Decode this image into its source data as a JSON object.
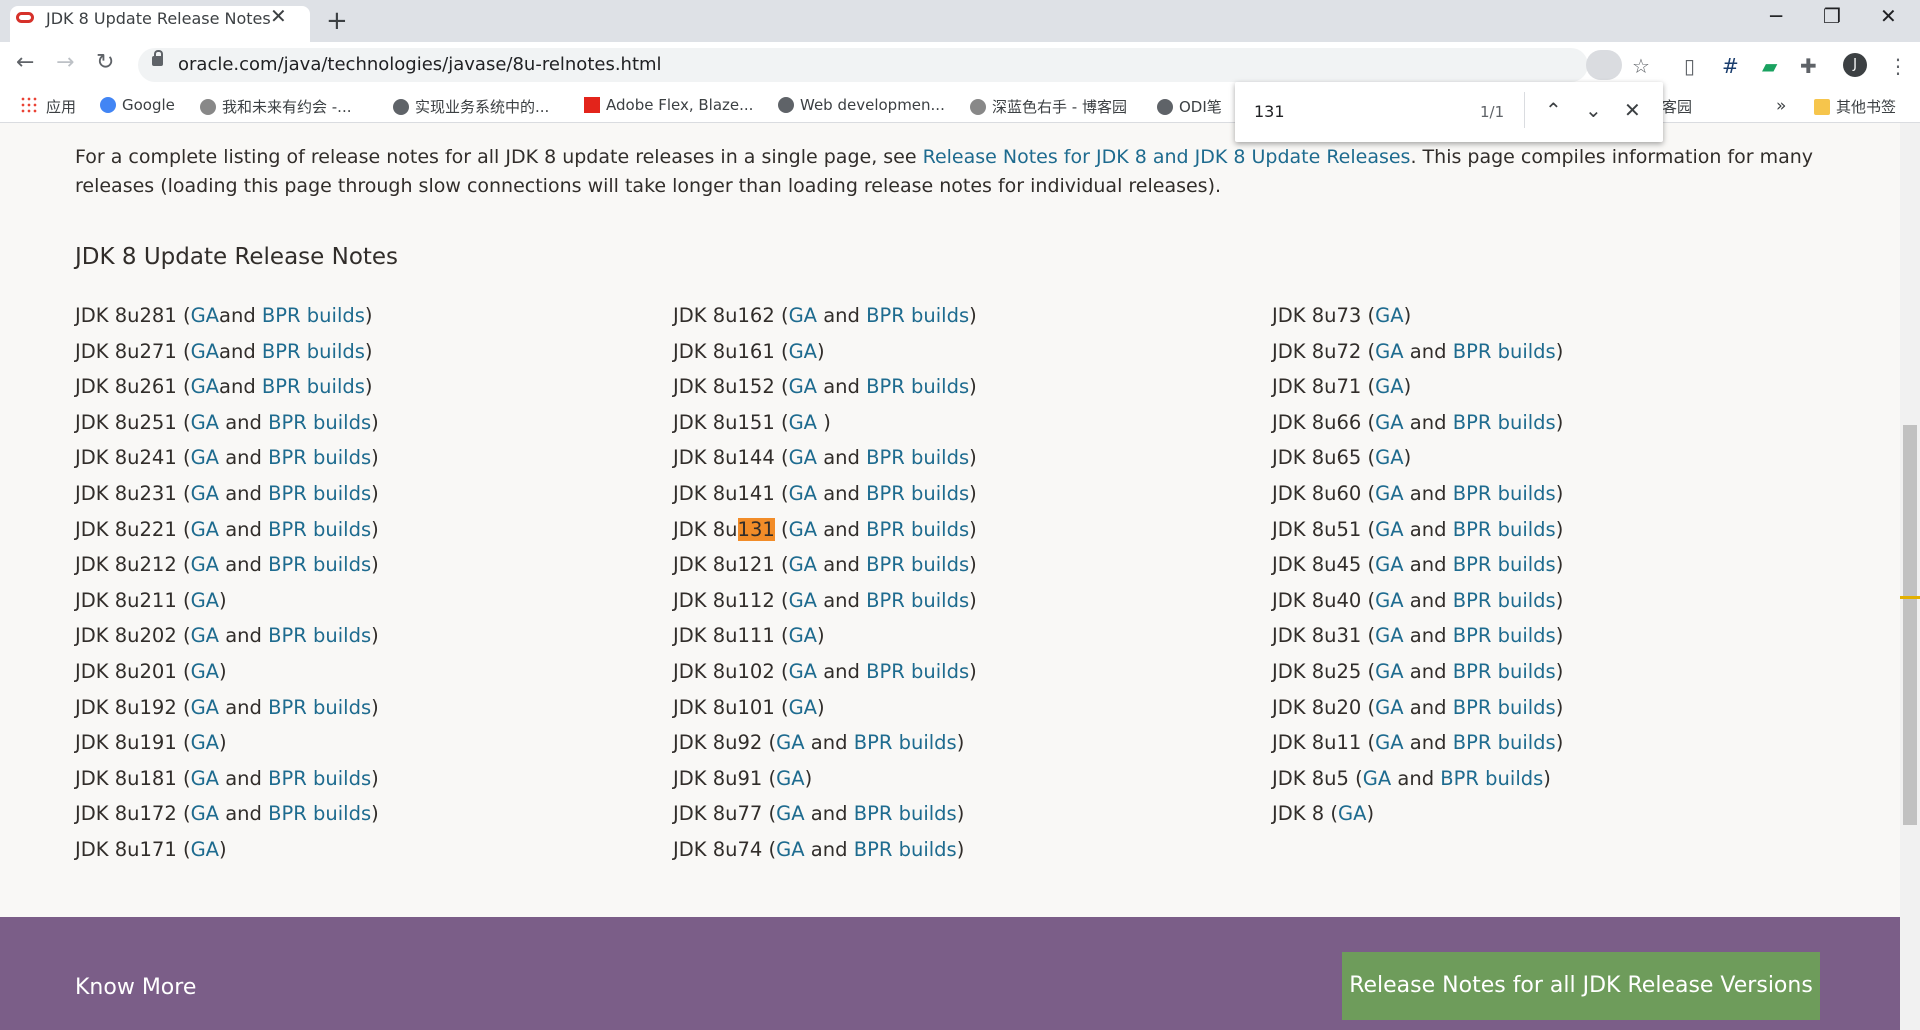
{
  "browser": {
    "tab_title": "JDK 8 Update Release Notes",
    "tab_close": "✕",
    "new_tab": "+",
    "url": "oracle.com/java/technologies/javase/8u-relnotes.html",
    "window_controls": {
      "minimize": "─",
      "maximize": "❐",
      "close": "✕"
    },
    "nav": {
      "back": "←",
      "forward": "→",
      "reload": "↻"
    },
    "bookmarks": [
      {
        "label": "应用",
        "icon": "apps-grid-icon"
      },
      {
        "label": "Google",
        "icon": "google-icon"
      },
      {
        "label": "我和未来有约会 -...",
        "icon": "bookmark-site-icon"
      },
      {
        "label": "实现业务系统中的...",
        "icon": "globe-icon"
      },
      {
        "label": "Adobe Flex, Blaze...",
        "icon": "adobe-icon"
      },
      {
        "label": "Web developmen...",
        "icon": "globe-icon"
      },
      {
        "label": "深蓝色右手 - 博客园",
        "icon": "bookmark-site-icon"
      },
      {
        "label": "ODI笔",
        "icon": "globe-icon"
      },
      {
        "label": "客园",
        "icon": ""
      }
    ],
    "bookmarks_more": "»",
    "other_bookmarks": "其他书签",
    "avatar_letter": "J",
    "find": {
      "query": "131",
      "count": "1/1",
      "prev": "⌃",
      "next": "⌄",
      "close": "✕"
    }
  },
  "page": {
    "intro_before": "For a complete listing of release notes for all JDK 8 update releases in a single page, see ",
    "intro_link": "Release Notes for JDK 8 and JDK 8 Update Releases",
    "intro_after": ". This page compiles information for many releases (loading this page through slow connections will take longer than loading release notes for individual releases).",
    "section_title": "JDK 8 Update Release Notes",
    "columns": [
      [
        {
          "name": "JDK 8u281",
          "ga": "GA",
          "join": "and ",
          "bpr": "BPR builds"
        },
        {
          "name": "JDK 8u271",
          "ga": "GA",
          "join": "and ",
          "bpr": "BPR builds"
        },
        {
          "name": "JDK 8u261",
          "ga": "GA",
          "join": "and ",
          "bpr": "BPR builds"
        },
        {
          "name": "JDK 8u251",
          "ga": "GA",
          "join": " and ",
          "bpr": "BPR builds"
        },
        {
          "name": "JDK 8u241",
          "ga": "GA",
          "join": " and ",
          "bpr": "BPR builds"
        },
        {
          "name": "JDK 8u231",
          "ga": "GA",
          "join": " and ",
          "bpr": "BPR builds"
        },
        {
          "name": "JDK 8u221",
          "ga": "GA",
          "join": " and ",
          "bpr": "BPR builds"
        },
        {
          "name": "JDK 8u212",
          "ga": "GA",
          "join": " and ",
          "bpr": "BPR builds"
        },
        {
          "name": "JDK 8u211",
          "ga": "GA"
        },
        {
          "name": "JDK 8u202",
          "ga": "GA",
          "join": " and ",
          "bpr": "BPR builds"
        },
        {
          "name": "JDK 8u201",
          "ga": "GA"
        },
        {
          "name": "JDK 8u192",
          "ga": "GA",
          "join": " and ",
          "bpr": "BPR builds"
        },
        {
          "name": "JDK 8u191",
          "ga": "GA"
        },
        {
          "name": "JDK 8u181",
          "ga": "GA",
          "join": " and ",
          "bpr": "BPR builds"
        },
        {
          "name": "JDK 8u172",
          "ga": "GA",
          "join": " and ",
          "bpr": "BPR builds"
        },
        {
          "name": "JDK 8u171",
          "ga": "GA"
        }
      ],
      [
        {
          "name": "JDK 8u162",
          "ga": "GA",
          "join": " and ",
          "bpr": "BPR builds"
        },
        {
          "name": "JDK 8u161",
          "ga": "GA"
        },
        {
          "name": "JDK 8u152",
          "ga": "GA",
          "join": " and ",
          "bpr": "BPR builds"
        },
        {
          "name": "JDK 8u151",
          "ga": "GA "
        },
        {
          "name": "JDK 8u144",
          "ga": "GA",
          "join": " and ",
          "bpr": "BPR builds"
        },
        {
          "name": "JDK 8u141",
          "ga": "GA",
          "join": " and ",
          "bpr": "BPR builds"
        },
        {
          "name": "JDK 8u131",
          "ga": "GA",
          "join": " and ",
          "bpr": "BPR builds",
          "highlight": "131"
        },
        {
          "name": "JDK 8u121",
          "ga": "GA",
          "join": " and ",
          "bpr": "BPR builds"
        },
        {
          "name": "JDK 8u112",
          "ga": "GA",
          "join": " and ",
          "bpr": "BPR builds"
        },
        {
          "name": "JDK 8u111",
          "ga": "GA"
        },
        {
          "name": "JDK 8u102",
          "ga": "GA",
          "join": " and ",
          "bpr": "BPR builds"
        },
        {
          "name": "JDK 8u101",
          "ga": "GA"
        },
        {
          "name": "JDK 8u92",
          "ga": "GA",
          "join": " and ",
          "bpr": "BPR builds"
        },
        {
          "name": "JDK 8u91",
          "ga": "GA"
        },
        {
          "name": "JDK 8u77",
          "ga": "GA",
          "join": " and ",
          "bpr": "BPR builds"
        },
        {
          "name": "JDK 8u74",
          "ga": "GA",
          "join": " and ",
          "bpr": "BPR builds"
        }
      ],
      [
        {
          "name": "JDK 8u73",
          "ga": "GA"
        },
        {
          "name": "JDK 8u72",
          "ga": "GA",
          "join": " and ",
          "bpr": "BPR builds"
        },
        {
          "name": "JDK 8u71",
          "ga": "GA"
        },
        {
          "name": "JDK 8u66",
          "ga": "GA",
          "join": " and ",
          "bpr": "BPR builds"
        },
        {
          "name": "JDK 8u65",
          "ga": "GA"
        },
        {
          "name": "JDK 8u60",
          "ga": "GA",
          "join": " and ",
          "bpr": "BPR builds"
        },
        {
          "name": "JDK 8u51",
          "ga": "GA",
          "join": " and ",
          "bpr": "BPR builds"
        },
        {
          "name": "JDK 8u45",
          "ga": "GA",
          "join": " and ",
          "bpr": "BPR builds"
        },
        {
          "name": "JDK 8u40",
          "ga": "GA",
          "join": " and ",
          "bpr": "BPR builds"
        },
        {
          "name": "JDK 8u31",
          "ga": "GA",
          "join": " and ",
          "bpr": "BPR builds"
        },
        {
          "name": "JDK 8u25",
          "ga": "GA",
          "join": " and ",
          "bpr": "BPR builds"
        },
        {
          "name": "JDK 8u20",
          "ga": "GA",
          "join": " and ",
          "bpr": "BPR builds"
        },
        {
          "name": "JDK 8u11",
          "ga": "GA",
          "join": " and ",
          "bpr": "BPR builds"
        },
        {
          "name": "JDK 8u5",
          "ga": "GA",
          "join": " and ",
          "bpr": "BPR builds"
        },
        {
          "name": "JDK 8",
          "ga": "GA"
        }
      ]
    ],
    "footer": {
      "know_more": "Know More",
      "release_button": "Release Notes for all JDK Release Versions"
    }
  },
  "colors": {
    "link": "#1e6b8f",
    "footer": "#7b5e88",
    "button": "#6e9c5b",
    "highlight": "#f28c28"
  }
}
